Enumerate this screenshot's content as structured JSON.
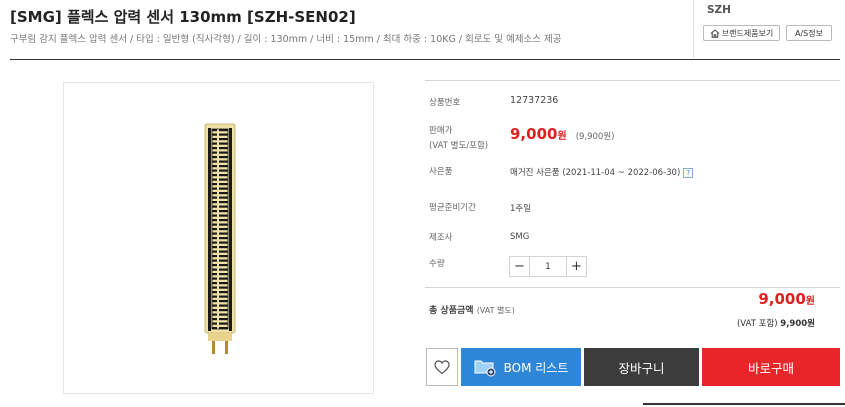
{
  "product": {
    "title": "[SMG] 플렉스 압력 센서 130mm [SZH-SEN02]",
    "subtitle": "구부림 감지 플렉스 압력 센서 / 타입 : 일반형 (직사각형) / 길이 : 130mm / 너비 : 15mm / 최대 하중 : 10KG / 회로도 및 예제소스 제공"
  },
  "brand": {
    "name": "SZH",
    "brand_products_label": "브랜드제품보기",
    "as_info_label": "A/S정보"
  },
  "details": {
    "product_number_label": "상품번호",
    "product_number": "12737236",
    "price_label_1": "판매가",
    "price_label_2": "(VAT 별도/포함)",
    "price": "9,000",
    "price_unit": "원",
    "price_incl_vat": "(9,900원)",
    "gift_label": "사은품",
    "gift_value": "매거진 사은품 (2021-11-04 ~ 2022-06-30)",
    "gift_help": "?",
    "prep_label": "평균준비기간",
    "prep_value": "1주일",
    "maker_label": "제조사",
    "maker_value": "SMG",
    "qty_label": "수량",
    "qty_minus": "−",
    "qty_value": "1",
    "qty_plus": "+"
  },
  "total": {
    "label": "총 상품금액",
    "label_note": "(VAT 별도)",
    "price": "9,000",
    "unit": "원",
    "vat_label": "(VAT 포함)",
    "vat_price": "9,900원"
  },
  "actions": {
    "bom_label": "BOM 리스트",
    "cart_label": "장바구니",
    "buy_label": "바로구매"
  },
  "colors": {
    "price_red": "#e02020",
    "bom_blue": "#2e86d6",
    "cart_dark": "#3c3c3c",
    "buy_red": "#e8262a",
    "link_blue": "#3a79c4"
  },
  "icons": {
    "brand_button": "home-icon",
    "wishlist": "heart-icon",
    "bom": "folder-add-icon",
    "gift_help": "question-icon"
  }
}
